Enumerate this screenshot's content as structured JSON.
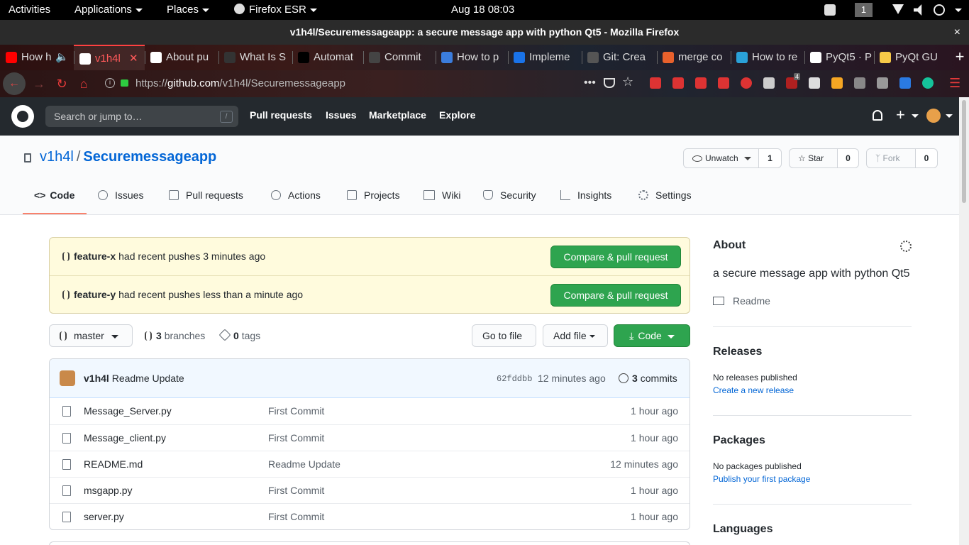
{
  "gnome": {
    "activities": "Activities",
    "applications": "Applications",
    "places": "Places",
    "app_name": "Firefox ESR",
    "clock": "Aug 18  08:03",
    "workspace": "1"
  },
  "window": {
    "title": "v1h4l/Securemessageapp: a secure message app with python Qt5 - Mozilla Firefox",
    "close": "×"
  },
  "tabs": [
    {
      "label": "How h",
      "color": "#ff0000"
    },
    {
      "label": "v1h4l",
      "color": "#ffffff"
    },
    {
      "label": "About pu",
      "color": "#ffffff"
    },
    {
      "label": "What Is S",
      "color": "#333333"
    },
    {
      "label": "Automat",
      "color": "#000000"
    },
    {
      "label": "Commit",
      "color": "#444444"
    },
    {
      "label": "How to p",
      "color": "#3b7ddd"
    },
    {
      "label": "Impleme",
      "color": "#1a73e8"
    },
    {
      "label": "Git: Crea",
      "color": "#555555"
    },
    {
      "label": "merge co",
      "color": "#e8612c"
    },
    {
      "label": "How to re",
      "color": "#2aa1d8"
    },
    {
      "label": "PyQt5 · P",
      "color": "#ffffff"
    },
    {
      "label": "PyQt GU",
      "color": "#f7c948"
    }
  ],
  "tab_close": "✕",
  "newtab": "+",
  "nav": {
    "url_prefix": "https://",
    "url_host": "github.com",
    "url_path": "/v1h4l/Securemessageapp",
    "ext_badge": "4"
  },
  "github": {
    "search_placeholder": "Search or jump to…",
    "search_key": "/",
    "nav": [
      "Pull requests",
      "Issues",
      "Marketplace",
      "Explore"
    ],
    "plus": "+"
  },
  "repo": {
    "owner": "v1h4l",
    "sep": "/",
    "name": "Securemessageapp",
    "unwatch": "Unwatch",
    "watch_count": "1",
    "star": "Star",
    "star_count": "0",
    "fork": "Fork",
    "fork_count": "0",
    "tabs": [
      "Code",
      "Issues",
      "Pull requests",
      "Actions",
      "Projects",
      "Wiki",
      "Security",
      "Insights",
      "Settings"
    ]
  },
  "pushes": [
    {
      "branch": "feature-x",
      "text": "had recent pushes 3 minutes ago",
      "button": "Compare & pull request"
    },
    {
      "branch": "feature-y",
      "text": "had recent pushes less than a minute ago",
      "button": "Compare & pull request"
    }
  ],
  "branchbar": {
    "branch": "master",
    "branches_count": "3",
    "branches_label": "branches",
    "tags_count": "0",
    "tags_label": "tags",
    "goto_file": "Go to file",
    "add_file": "Add file",
    "code": "Code"
  },
  "commit": {
    "author": "v1h4l",
    "message": "Readme Update",
    "sha": "62fddbb",
    "time": "12 minutes ago",
    "count": "3",
    "count_label": "commits"
  },
  "files": [
    {
      "name": "Message_Server.py",
      "message": "First Commit",
      "age": "1 hour ago"
    },
    {
      "name": "Message_client.py",
      "message": "First Commit",
      "age": "1 hour ago"
    },
    {
      "name": "README.md",
      "message": "Readme Update",
      "age": "12 minutes ago"
    },
    {
      "name": "msgapp.py",
      "message": "First Commit",
      "age": "1 hour ago"
    },
    {
      "name": "server.py",
      "message": "First Commit",
      "age": "1 hour ago"
    }
  ],
  "sidebar": {
    "about_title": "About",
    "description": "a secure message app with python Qt5",
    "readme": "Readme",
    "releases_title": "Releases",
    "releases_text": "No releases published",
    "releases_link": "Create a new release",
    "packages_title": "Packages",
    "packages_text": "No packages published",
    "packages_link": "Publish your first package",
    "languages_title": "Languages"
  }
}
